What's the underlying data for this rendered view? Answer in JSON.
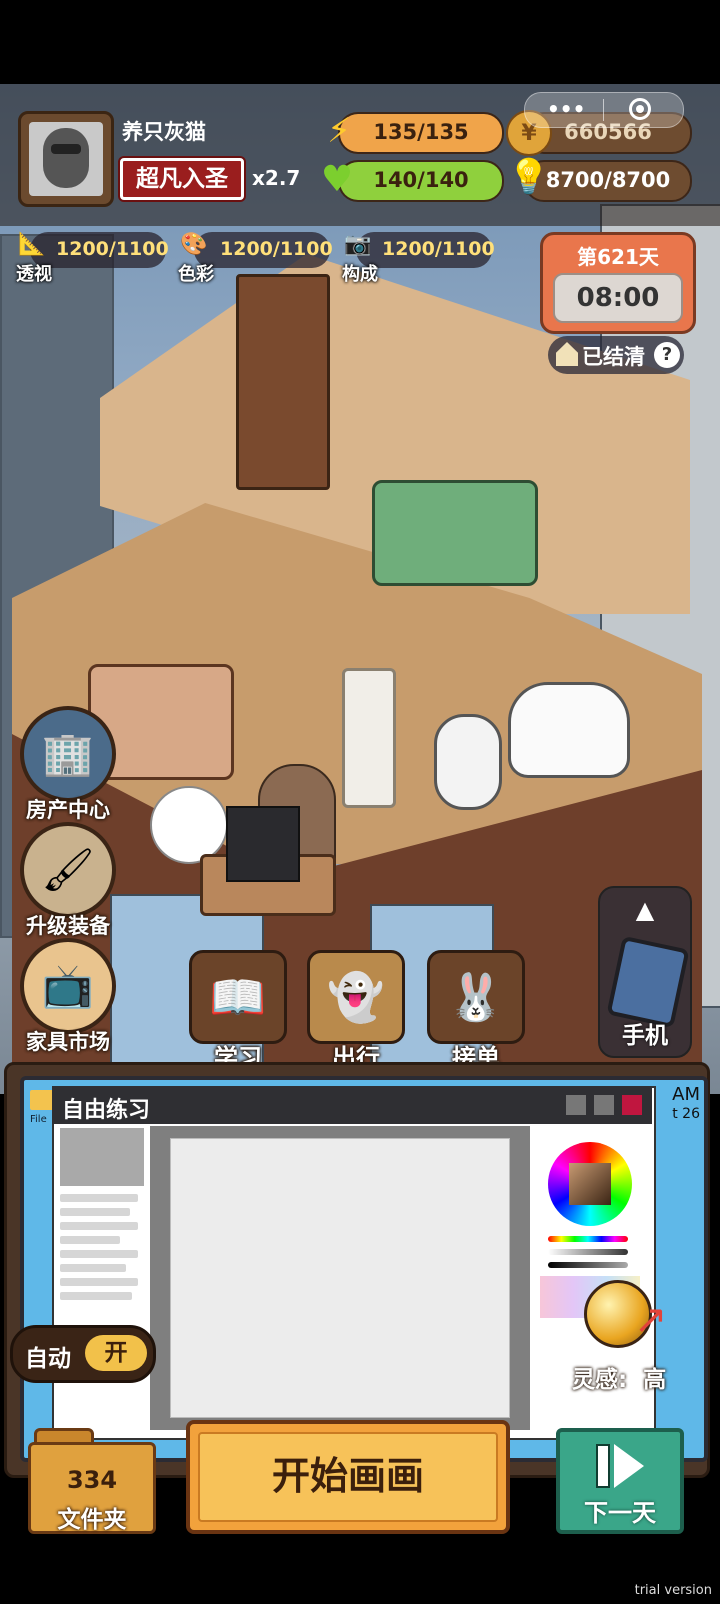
{
  "player": {
    "name": "养只灰猫",
    "rank": "超凡入圣",
    "multiplier": "x2.7"
  },
  "resources": {
    "energy": {
      "label": "135/135",
      "fraction": 1.0
    },
    "health": {
      "label": "140/140",
      "fraction": 1.0
    },
    "coins": "660566",
    "inspiration_pool": "8700/8700"
  },
  "skills": [
    {
      "name": "透视",
      "value": "1200/1100",
      "icon": "ruler-icon"
    },
    {
      "name": "色彩",
      "value": "1200/1100",
      "icon": "palette-icon"
    },
    {
      "name": "构成",
      "value": "1200/1100",
      "icon": "camera-icon"
    }
  ],
  "day": {
    "label": "第621天",
    "time": "08:00"
  },
  "cleared": {
    "label": "已结清",
    "help": "?"
  },
  "side_menu": [
    {
      "label": "房产中心",
      "icon": "building-icon"
    },
    {
      "label": "升级装备",
      "icon": "brush-pen-icon"
    },
    {
      "label": "家具市场",
      "icon": "tv-furniture-icon"
    }
  ],
  "actions": [
    {
      "label": "学习",
      "icon": "book-icon"
    },
    {
      "label": "出行",
      "icon": "ghost-icon"
    },
    {
      "label": "接单",
      "icon": "rabbit-icon"
    }
  ],
  "phone": {
    "label": "手机",
    "expand": "▲"
  },
  "app": {
    "title": "自由练习",
    "desktop_file_label": "File",
    "clock_fragment": "AM",
    "date_fragment": "t 26"
  },
  "auto": {
    "label": "自动",
    "state": "开"
  },
  "inspiration": {
    "label": "灵感:",
    "level": "高"
  },
  "folder": {
    "count": "334",
    "label": "文件夹"
  },
  "start_button": "开始画画",
  "next_day": "下一天",
  "watermark": "trial version",
  "wechat_capsule": {
    "more": "•••"
  },
  "colors": {
    "energy_fill": "#f0a44a",
    "health_fill": "#8fd03d",
    "coin_fill": "#6e4c30",
    "accent_orange": "#f2a23c",
    "next_green": "#3aa689"
  }
}
